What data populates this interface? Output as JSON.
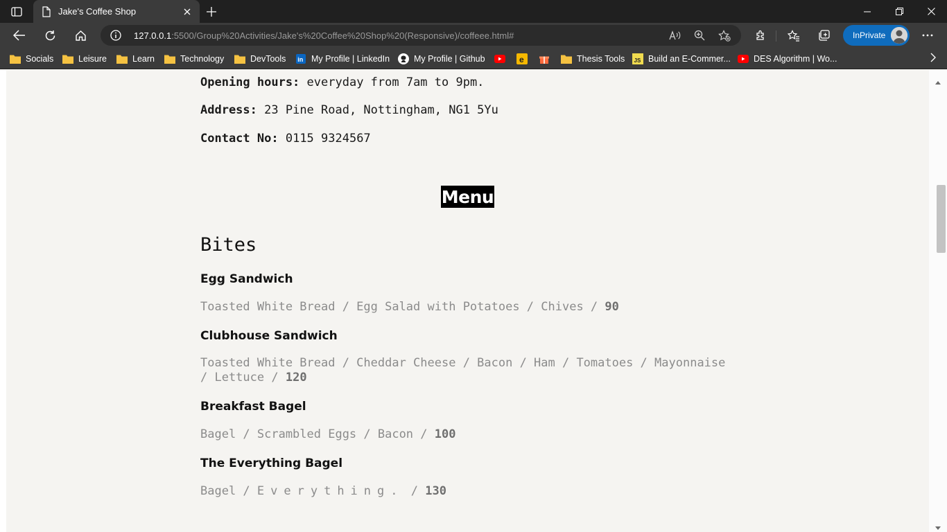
{
  "browser": {
    "tab": {
      "title": "Jake's Coffee Shop"
    },
    "address": {
      "host": "127.0.0.1",
      "rest": ":5500/Group%20Activities/Jake's%20Coffee%20Shop%20(Responsive)/coffeee.html#"
    },
    "inprivate_label": "InPrivate",
    "bookmarks": [
      {
        "label": "Socials",
        "icon": "folder-icon"
      },
      {
        "label": "Leisure",
        "icon": "folder-icon"
      },
      {
        "label": "Learn",
        "icon": "folder-icon"
      },
      {
        "label": "Technology",
        "icon": "folder-icon"
      },
      {
        "label": "DevTools",
        "icon": "folder-icon"
      },
      {
        "label": "My Profile | LinkedIn",
        "icon": "linkedin-icon"
      },
      {
        "label": "My Profile | Github",
        "icon": "github-icon"
      },
      {
        "label": "",
        "icon": "youtube-icon"
      },
      {
        "label": "",
        "icon": "e-icon"
      },
      {
        "label": "",
        "icon": "gift-icon"
      },
      {
        "label": "Thesis Tools",
        "icon": "folder-icon"
      },
      {
        "label": "Build an E-Commer...",
        "icon": "js-icon"
      },
      {
        "label": "DES Algorithm | Wo...",
        "icon": "youtube-icon"
      }
    ]
  },
  "page": {
    "info": {
      "hours_label": "Opening hours:",
      "hours_value": "everyday from 7am to 9pm.",
      "address_label": "Address:",
      "address_value": "23 Pine Road, Nottingham, NG1 5Yu",
      "contact_label": "Contact No:",
      "contact_value": "0115 9324567"
    },
    "menu_title": "Menu",
    "section": "Bites",
    "items": [
      {
        "name": "Egg Sandwich",
        "desc": "Toasted White Bread / Egg Salad with Potatoes / Chives /",
        "price": "90"
      },
      {
        "name": "Clubhouse Sandwich",
        "desc": "Toasted White Bread / Cheddar Cheese / Bacon / Ham / Tomatoes / Mayonnaise / Lettuce /",
        "price": "120"
      },
      {
        "name": "Breakfast Bagel",
        "desc": "Bagel / Scrambled Eggs / Bacon /",
        "price": "100"
      },
      {
        "name": "The Everything Bagel",
        "desc_a": "Bagel /",
        "desc_spaced": "Everything.",
        "desc_b": "/",
        "price": "130"
      }
    ]
  },
  "colors": {
    "page_bg": "#f5f4f1",
    "menu_badge_bg": "#000000",
    "desc_text": "#8b8b8b",
    "inprivate_bg": "#0f6cbd"
  }
}
